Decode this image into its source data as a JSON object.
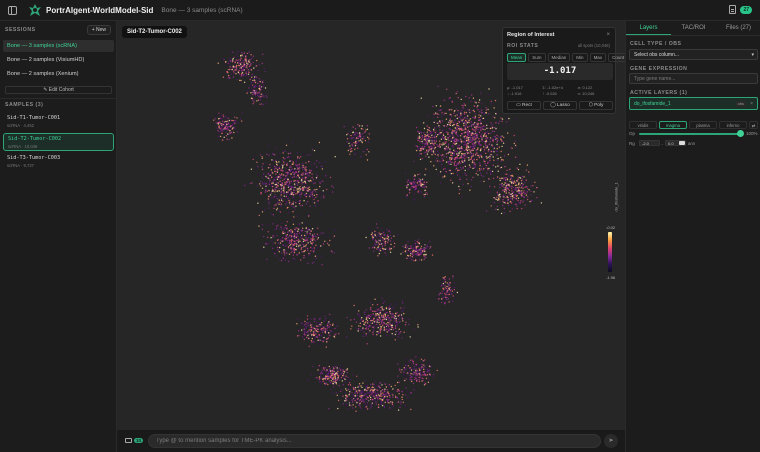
{
  "app": {
    "title": "PortrAIgent-WorldModel-Sid",
    "subtitle": "Bone — 3 samples (scRNA)",
    "notification_count": "27"
  },
  "sidebar": {
    "sessions_header": "SESSIONS",
    "new_label": "+ New",
    "sessions": [
      {
        "label": "Bone — 3 samples (scRNA)",
        "active": true
      },
      {
        "label": "Bone — 2 samples (VisiumHD)",
        "active": false
      },
      {
        "label": "Bone — 2 samples (Xenium)",
        "active": false
      }
    ],
    "edit_cohort_label": "Edit Cohort",
    "samples_header": "SAMPLES (3)",
    "samples": [
      {
        "name": "Sid-T1-Tumor-C001",
        "meta": "scRNA · 4,452",
        "active": false
      },
      {
        "name": "Sid-T2-Tumor-C002",
        "meta": "scRNA · 10,046",
        "active": true
      },
      {
        "name": "Sid-T3-Tumor-C003",
        "meta": "scRNA · 9,727",
        "active": false
      }
    ]
  },
  "canvas": {
    "sample_label": "Sid-T2-Tumor-C002",
    "roi": {
      "title": "Region of Interest",
      "close_icon": "×",
      "stats_header": "ROI STATS",
      "spots_label": "all spots (10,046)",
      "stat_buttons": [
        "Mean",
        "Sum",
        "Median",
        "Min",
        "Max",
        "Count"
      ],
      "active_stat": "Mean",
      "value": "-1.017",
      "details": [
        "μ: -1.017",
        "Σ: -1.02e+4",
        "σ: 0.122",
        "↓ -1.916",
        "↑ -0.026",
        "n: 10,046"
      ],
      "tools": [
        "▭ Rect",
        "◯ Lasso",
        "⬡ Poly"
      ]
    },
    "colorbar": {
      "title": "do_ifosfamide_1",
      "max": "-0.02",
      "min": "-1.96"
    },
    "chat": {
      "count": "10",
      "placeholder": "Type @ to mention samples for TME-PK analysis...",
      "send_icon": "➤"
    }
  },
  "right_panel": {
    "tabs": [
      {
        "label": "Layers",
        "active": true
      },
      {
        "label": "TAC/ROI",
        "active": false
      },
      {
        "label": "Files (27)",
        "active": false
      }
    ],
    "cell_type_header": "CELL TYPE / OBS",
    "select_value": "Select obs column...",
    "gene_header": "GENE EXPRESSION",
    "gene_placeholder": "Type gene name...",
    "active_layers_header": "ACTIVE LAYERS (1)",
    "layer": {
      "name": "do_ifosfamide_1",
      "badge": "obs",
      "close": "×"
    },
    "colormaps": [
      "viridis",
      "magma",
      "plasma",
      "inferno"
    ],
    "active_colormap": "magma",
    "swap_icon": "⇄",
    "opacity_label": "Op",
    "opacity": 1.0,
    "opacity_value": "100%",
    "range_label": "Rg",
    "range_min": "-2.0",
    "range_max": "0.0",
    "range_unit": "ann"
  },
  "colors": {
    "accent": "#3fd196",
    "accent_border": "#2da577",
    "background": "#161616"
  }
}
